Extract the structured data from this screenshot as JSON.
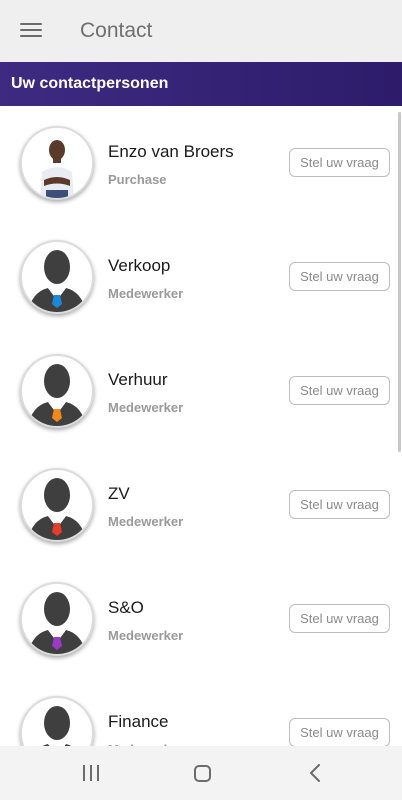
{
  "appbar": {
    "title": "Contact",
    "menu_icon": "hamburger-menu-icon"
  },
  "section": {
    "title": "Uw contactpersonen"
  },
  "contacts": [
    {
      "name": "Enzo van Broers",
      "role": "Purchase",
      "button_label": "Stel uw vraag",
      "avatar": "photo"
    },
    {
      "name": "Verkoop",
      "role": "Medewerker",
      "button_label": "Stel uw vraag",
      "avatar": "silhouette",
      "tie_color": "#1e88d8"
    },
    {
      "name": "Verhuur",
      "role": "Medewerker",
      "button_label": "Stel uw vraag",
      "avatar": "silhouette",
      "tie_color": "#f08a1c"
    },
    {
      "name": "ZV",
      "role": "Medewerker",
      "button_label": "Stel uw vraag",
      "avatar": "silhouette",
      "tie_color": "#e53d2a"
    },
    {
      "name": "S&O",
      "role": "Medewerker",
      "button_label": "Stel uw vraag",
      "avatar": "silhouette",
      "tie_color": "#9b3bc4"
    },
    {
      "name": "Finance",
      "role": "Medewerker",
      "button_label": "Stel uw vraag",
      "avatar": "silhouette",
      "tie_color": "#2f8f3a"
    }
  ],
  "colors": {
    "header_gradient_start": "#3d2b82",
    "header_gradient_end": "#2d1c6a",
    "appbar_bg": "#efefef"
  },
  "navbar": {
    "icons": [
      "recents-icon",
      "home-icon",
      "back-icon"
    ]
  }
}
